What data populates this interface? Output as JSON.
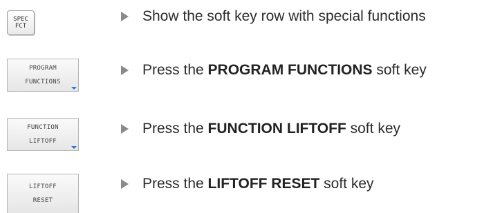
{
  "steps": [
    {
      "key_type": "hardware",
      "key_lines": [
        "SPEC",
        "FCT"
      ],
      "text": "Show the soft key row with special functions"
    },
    {
      "key_type": "softkey",
      "key_lines": [
        "PROGRAM",
        "FUNCTIONS"
      ],
      "has_submenu": true,
      "text_before": "Press the ",
      "text_bold": "PROGRAM FUNCTIONS",
      "text_after": " soft key"
    },
    {
      "key_type": "softkey",
      "key_lines": [
        "FUNCTION",
        "LIFTOFF"
      ],
      "has_submenu": true,
      "text_before": "Press the ",
      "text_bold": "FUNCTION LIFTOFF",
      "text_after": " soft key"
    },
    {
      "key_type": "softkey",
      "key_lines": [
        "LIFTOFF",
        "RESET"
      ],
      "has_submenu": false,
      "text_before": "Press the ",
      "text_bold": "LIFTOFF RESET",
      "text_after": " soft key"
    }
  ],
  "colors": {
    "arrow": "#8a8a8a",
    "submenu_indicator": "#2b7bd6"
  }
}
